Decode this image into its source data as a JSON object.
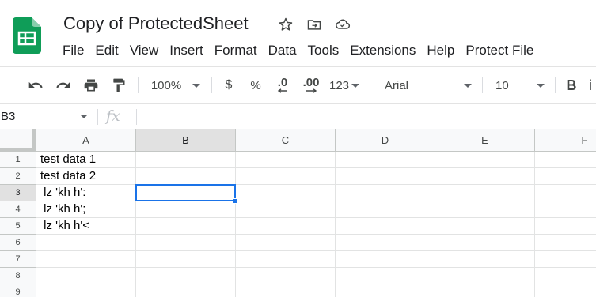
{
  "app": {
    "title": "Copy of ProtectedSheet",
    "brand_color": "#0f9d58"
  },
  "title_icons": [
    "star-icon",
    "move-folder-icon",
    "cloud-status-icon"
  ],
  "menu": [
    "File",
    "Edit",
    "View",
    "Insert",
    "Format",
    "Data",
    "Tools",
    "Extensions",
    "Help",
    "Protect File"
  ],
  "toolbar": {
    "undo_icon": "undo-icon",
    "redo_icon": "redo-icon",
    "print_icon": "print-icon",
    "paint_format_icon": "paint-format-icon",
    "zoom": "100%",
    "currency": "$",
    "percent": "%",
    "decrease_decimal": ".0",
    "increase_decimal": ".00",
    "number_format": "123",
    "font": "Arial",
    "font_size": "10",
    "bold": "B"
  },
  "formula_bar": {
    "name_box": "B3",
    "fx": "fx",
    "formula": ""
  },
  "sheet": {
    "columns": [
      "A",
      "B",
      "C",
      "D",
      "E",
      "F"
    ],
    "rows": [
      "1",
      "2",
      "3",
      "4",
      "5",
      "6",
      "7",
      "8",
      "9"
    ],
    "selected_cell": "B3",
    "cells": {
      "A1": "test data 1",
      "A2": "test data 2",
      "A3": " lz 'kh h':",
      "A4": " lz 'kh h';",
      "A5": " lz 'kh h'<"
    },
    "selection_color": "#1a73e8"
  }
}
